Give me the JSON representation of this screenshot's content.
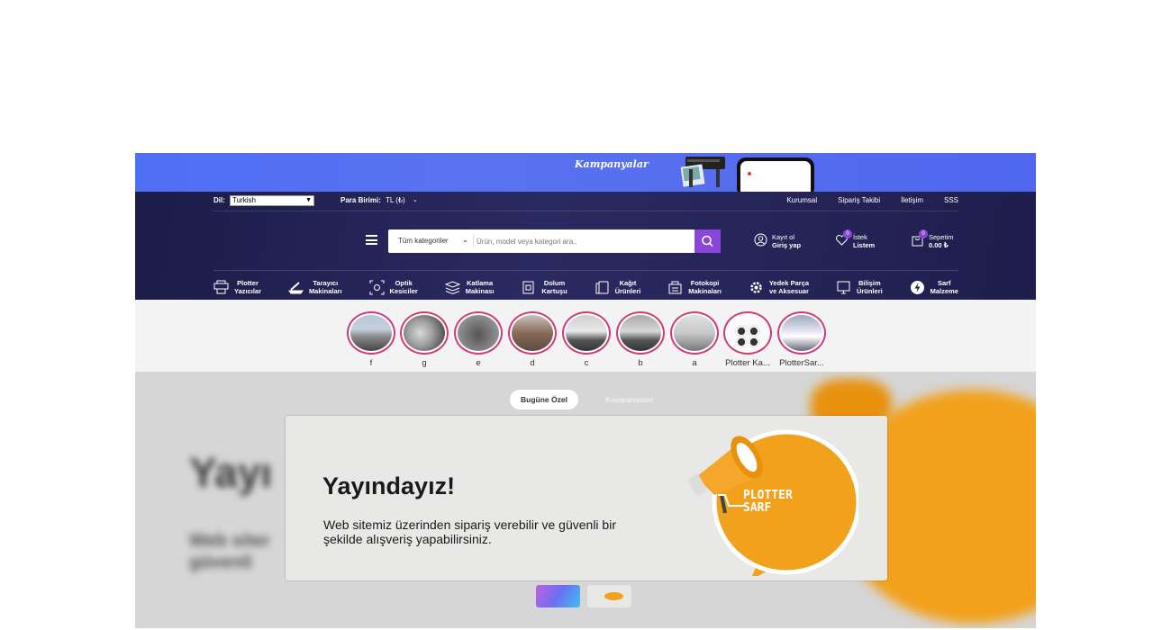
{
  "promo": {
    "text": "Kampanyalar"
  },
  "topbar": {
    "lang_label": "Dil:",
    "lang_value": "Turkish",
    "currency_label": "Para Birimi:",
    "currency_value": "TL (₺)",
    "links": [
      "Kurumsal",
      "Sipariş Takibi",
      "İletişim",
      "SSS"
    ]
  },
  "search": {
    "category": "Tüm kategoriler",
    "placeholder": "Ürün, model veya kategori ara.."
  },
  "account": {
    "line1": "Kayıt ol",
    "line2": "Giriş yap"
  },
  "wishlist": {
    "badge": "0",
    "line1": "İstek",
    "line2": "Listem"
  },
  "cart": {
    "badge": "0",
    "line1": "Sepetim",
    "line2": "0.00 ₺"
  },
  "categories": [
    {
      "l1": "Plotter",
      "l2": "Yazıcılar",
      "icon": "printer-icon"
    },
    {
      "l1": "Tarayıcı",
      "l2": "Makinaları",
      "icon": "scanner-icon"
    },
    {
      "l1": "Optik",
      "l2": "Kesiciler",
      "icon": "optic-cutter-icon"
    },
    {
      "l1": "Katlama",
      "l2": "Makinası",
      "icon": "layers-icon"
    },
    {
      "l1": "Dolum",
      "l2": "Kartuşu",
      "icon": "cartridge-icon"
    },
    {
      "l1": "Kağıt",
      "l2": "Ürünleri",
      "icon": "paper-icon"
    },
    {
      "l1": "Fotokopi",
      "l2": "Makinaları",
      "icon": "copier-icon"
    },
    {
      "l1": "Yedek Parça",
      "l2": "ve Aksesuar",
      "icon": "gear-icon"
    },
    {
      "l1": "Bilişim",
      "l2": "Ürünleri",
      "icon": "computer-icon"
    },
    {
      "l1": "Sarf",
      "l2": "Malzeme",
      "icon": "lightning-icon"
    }
  ],
  "stories": [
    "f",
    "g",
    "e",
    "d",
    "c",
    "b",
    "a",
    "Plotter Ka...",
    "PlotterSar..."
  ],
  "hero": {
    "tabs": [
      "Bugüne Özel",
      "Kampanyalar"
    ],
    "title": "Yayındayız!",
    "description": "Web sitemiz üzerinden sipariş verebilir ve güvenli bir şekilde alışveriş yapabilirsiniz.",
    "bg_title": "Yayı",
    "bg_line1": "Web siter",
    "bg_line2": "güvenli",
    "logo_line1": "PLOTTER",
    "logo_line2": "SARF"
  },
  "colors": {
    "accent": "#8a46d8",
    "header": "#22224f",
    "promo": "#5570f0",
    "story_ring": "#d03a7a",
    "orange": "#f1a11b"
  }
}
